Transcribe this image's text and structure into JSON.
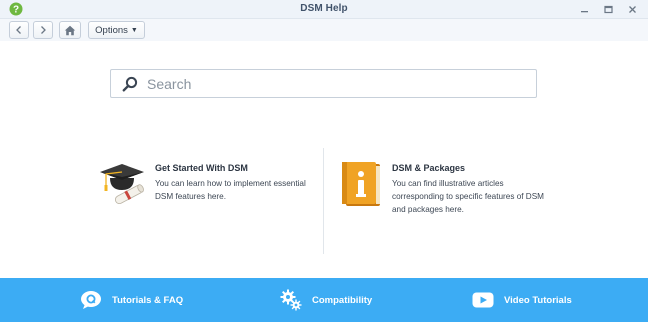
{
  "window": {
    "title": "DSM Help"
  },
  "toolbar": {
    "options_label": "Options"
  },
  "search": {
    "placeholder": "Search",
    "value": ""
  },
  "cards": [
    {
      "title": "Get Started With DSM",
      "description": "You can learn how to implement essential DSM features here."
    },
    {
      "title": "DSM & Packages",
      "description": "You can find illustrative articles corresponding to specific features of DSM and packages here."
    }
  ],
  "footer": {
    "items": [
      {
        "label": "Tutorials & FAQ",
        "icon": "chat-bubble-icon"
      },
      {
        "label": "Compatibility",
        "icon": "gears-icon"
      },
      {
        "label": "Video Tutorials",
        "icon": "youtube-play-icon"
      }
    ]
  },
  "colors": {
    "footer_bg": "#3cacf4",
    "titlebar_bg": "#eef3f9",
    "app_icon": "#6fb840"
  }
}
